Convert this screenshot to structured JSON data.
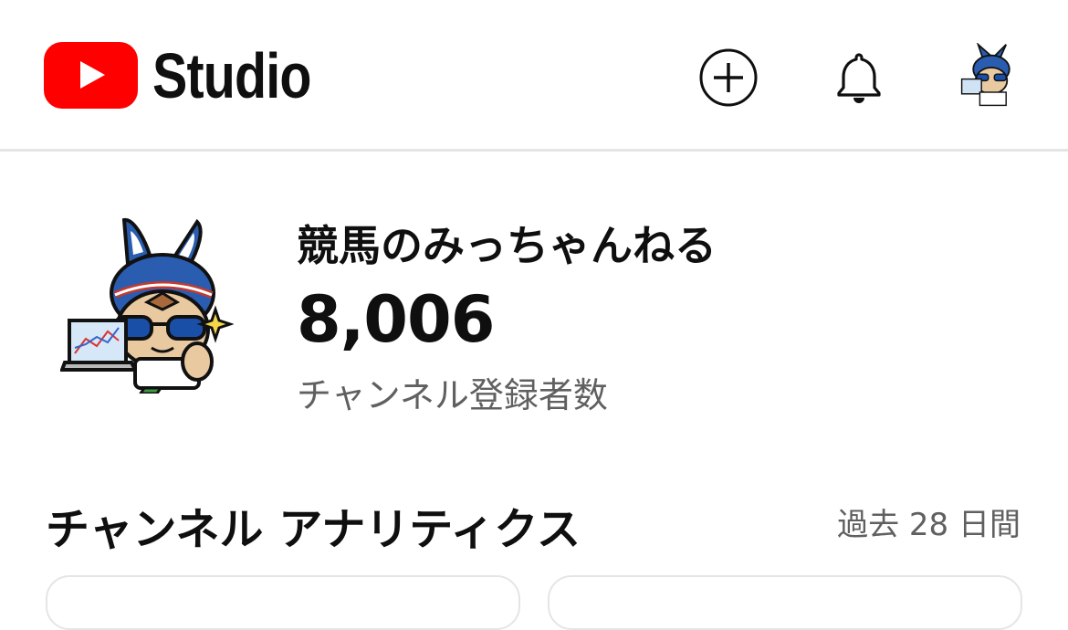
{
  "header": {
    "app_name": "Studio",
    "icons": {
      "logo": "youtube-play-icon",
      "create": "plus-circle-icon",
      "notifications": "bell-icon",
      "account": "channel-avatar"
    }
  },
  "channel": {
    "name": "競馬のみっちゃんねる",
    "subscriber_count": "8,006",
    "subscriber_label": "チャンネル登録者数"
  },
  "analytics": {
    "title": "チャンネル アナリティクス",
    "period": "過去 28 日間"
  },
  "colors": {
    "brand_red": "#ff0000",
    "text_primary": "#0f0f0f",
    "text_secondary": "#606060",
    "divider": "#e5e5e5"
  }
}
